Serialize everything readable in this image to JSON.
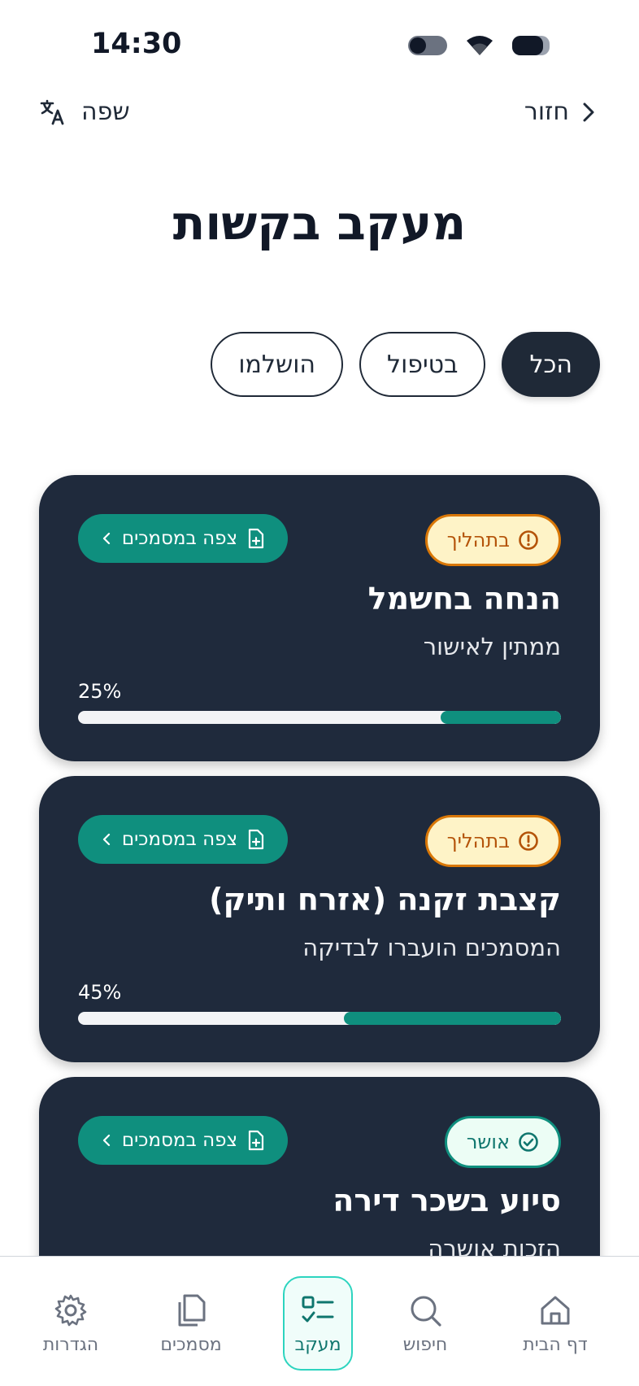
{
  "status_bar": {
    "time": "14:30"
  },
  "nav": {
    "back_label": "חזור",
    "language_label": "שפה"
  },
  "page": {
    "title": "מעקב בקשות"
  },
  "filters": [
    {
      "label": "הכל",
      "active": true
    },
    {
      "label": "בטיפול",
      "active": false
    },
    {
      "label": "הושלמו",
      "active": false
    }
  ],
  "requests": [
    {
      "status": "בתהליך",
      "status_type": "progress",
      "title": "הנחה בחשמל",
      "subtitle": "ממתין לאישור",
      "progress_label": "25%",
      "progress": 0.25,
      "docs_label": "צפה במסמכים"
    },
    {
      "status": "בתהליך",
      "status_type": "progress",
      "title": "קצבת זקנה (אזרח ותיק)",
      "subtitle": "המסמכים הועברו לבדיקה",
      "progress_label": "45%",
      "progress": 0.45,
      "docs_label": "צפה במסמכים"
    },
    {
      "status": "אושר",
      "status_type": "approved",
      "title": "סיוע בשכר דירה",
      "subtitle": "הזכות אושרה",
      "docs_label": "צפה במסמכים"
    }
  ],
  "tabs": [
    {
      "label": "דף הבית",
      "icon": "home-icon",
      "active": false
    },
    {
      "label": "חיפוש",
      "icon": "search-icon",
      "active": false
    },
    {
      "label": "מעקב",
      "icon": "tracking-icon",
      "active": true
    },
    {
      "label": "מסמכים",
      "icon": "documents-icon",
      "active": false
    },
    {
      "label": "הגדרות",
      "icon": "gear-icon",
      "active": false
    }
  ],
  "colors": {
    "card_bg": "#1f2a3c",
    "accent": "#0f8f7e",
    "warning": "#d97706",
    "warning_bg": "#fef3c7"
  }
}
